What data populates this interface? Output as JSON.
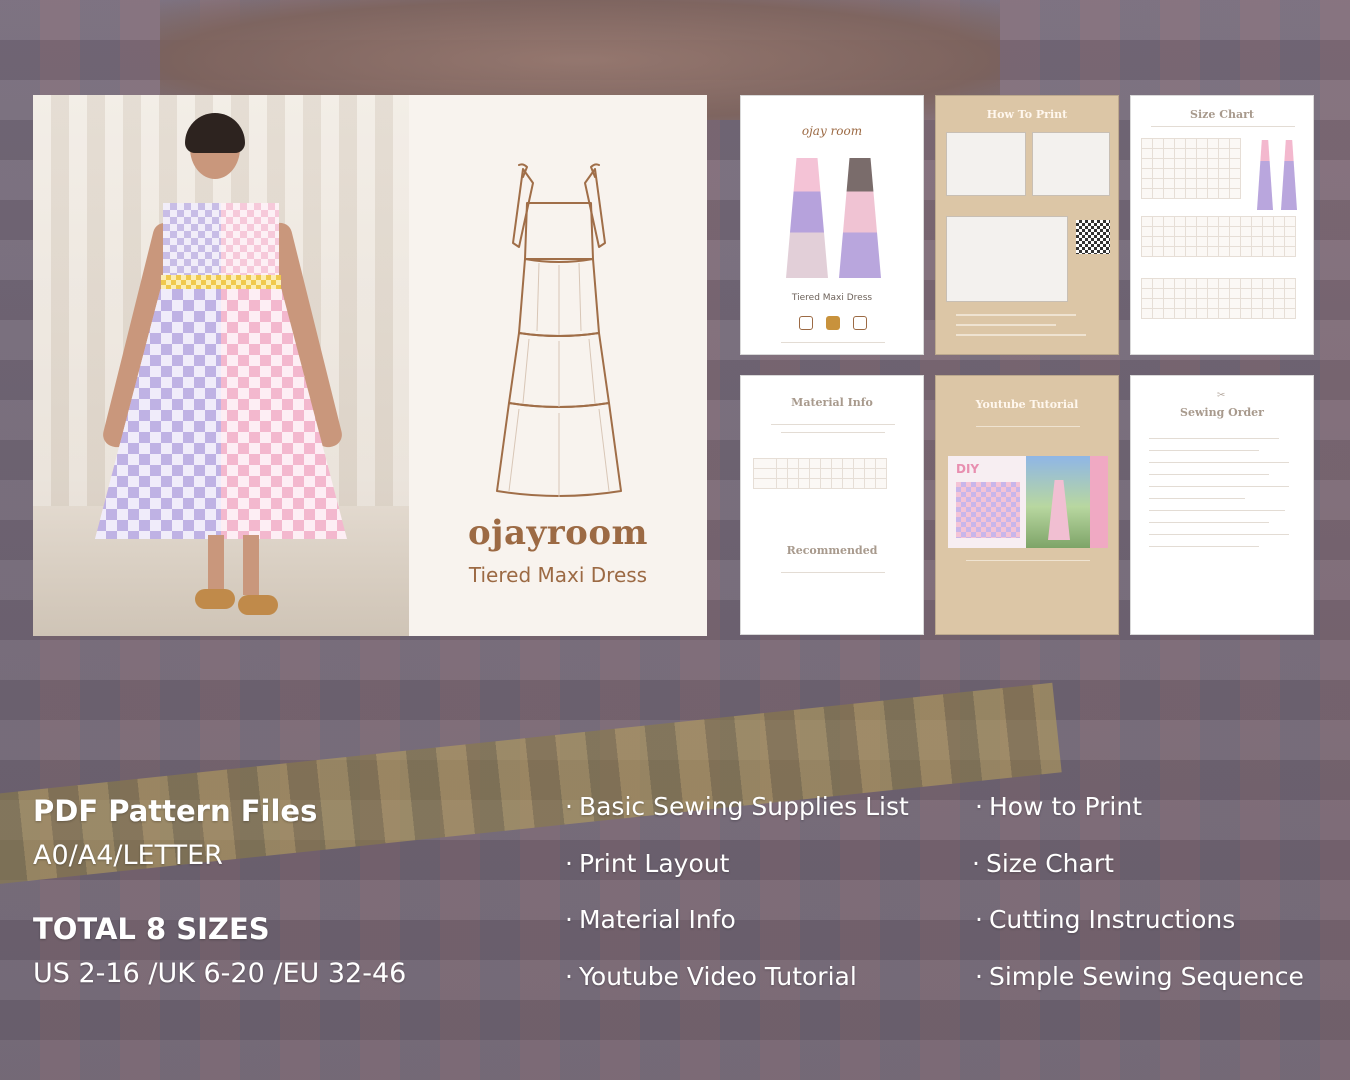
{
  "hero": {
    "brand": "ojayroom",
    "product": "Tiered Maxi Dress"
  },
  "pages": {
    "cover": {
      "logo": "ojay room",
      "caption": "Tiered Maxi Dress"
    },
    "how_to_print": {
      "title": "How To Print"
    },
    "size_chart": {
      "title": "Size Chart"
    },
    "material_info": {
      "title": "Material Info",
      "recommended": "Recommended"
    },
    "youtube_tutorial": {
      "title": "Youtube Tutorial",
      "badge": "DIY"
    },
    "sewing_order": {
      "title": "Sewing Order"
    }
  },
  "specs": {
    "files_title": "PDF Pattern Files",
    "files_formats": "A0/A4/LETTER",
    "sizes_title": "TOTAL 8 SIZES",
    "sizes_values": "US 2-16 /UK 6-20 /EU 32-46"
  },
  "features": {
    "left": [
      "Basic Sewing Supplies List",
      "Print Layout",
      "Material Info",
      "Youtube Video Tutorial"
    ],
    "right": [
      "How to Print",
      "Size Chart",
      "Cutting Instructions",
      "Simple Sewing Sequence"
    ],
    "bullet": "·"
  },
  "colors": {
    "brand_brown": "#9c6a44",
    "page_tan": "#dcc6a6",
    "text_white": "#ffffff"
  }
}
